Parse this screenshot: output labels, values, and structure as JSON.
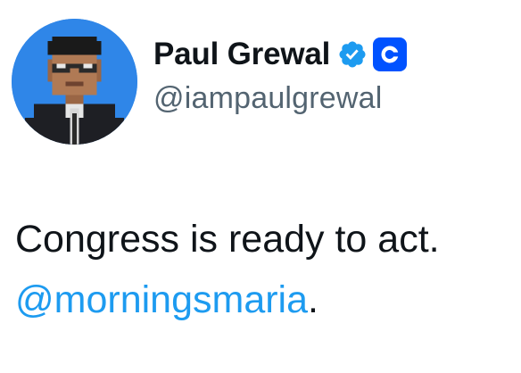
{
  "author": {
    "display_name": "Paul Grewal",
    "handle": "@iampaulgrewal",
    "verified_icon": "verified-badge-icon",
    "affiliate_icon": "coinbase-logo-icon"
  },
  "tweet": {
    "text_line1": "Congress is ready to act.",
    "mention": "@morningsmaria",
    "trailing": "."
  },
  "colors": {
    "text": "#0f1419",
    "secondary_text": "#536471",
    "link": "#1d9bf0",
    "verified": "#1d9bf0",
    "affiliate_bg": "#0052ff",
    "avatar_bg": "#2f86e8"
  }
}
